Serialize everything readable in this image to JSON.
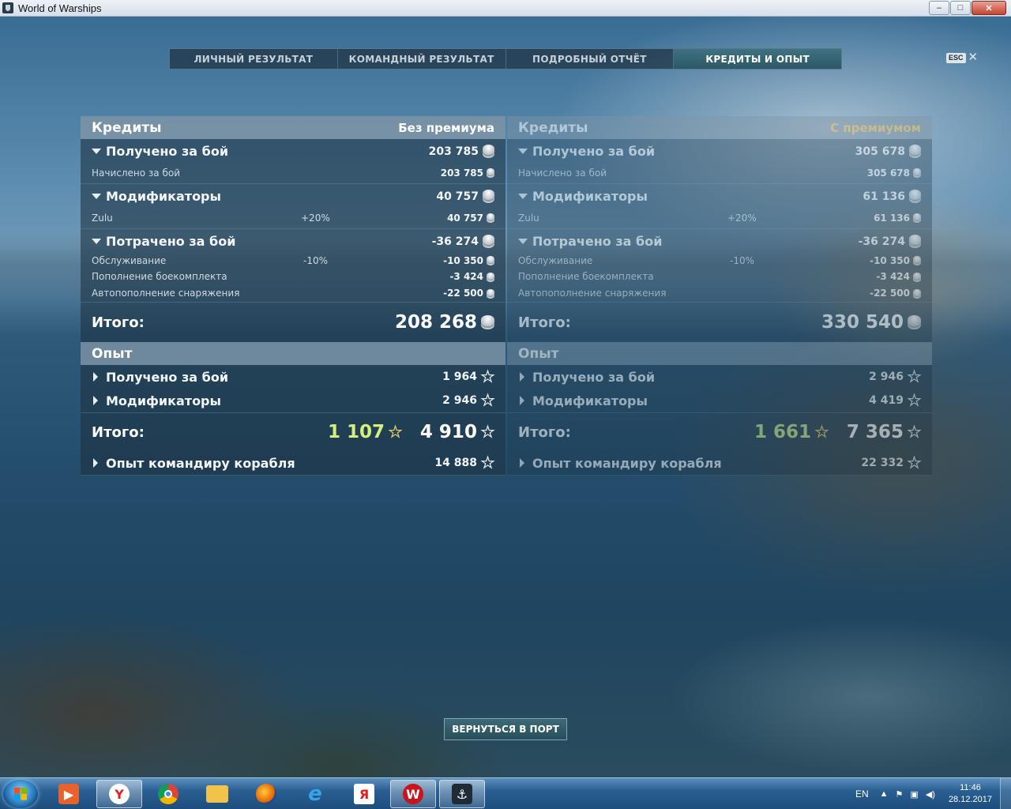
{
  "window": {
    "title": "World of Warships",
    "min": "–",
    "max": "□",
    "close": "✕"
  },
  "tabs": [
    {
      "label": "ЛИЧНЫЙ РЕЗУЛЬТАТ"
    },
    {
      "label": "КОМАНДНЫЙ РЕЗУЛЬТАТ"
    },
    {
      "label": "ПОДРОБНЫЙ ОТЧЁТ"
    },
    {
      "label": "КРЕДИТЫ И ОПЫТ"
    }
  ],
  "active_tab": "КРЕДИТЫ И ОПЫТ",
  "esc": {
    "key": "ESC",
    "close": "✕"
  },
  "left": {
    "credits_title": "Кредиты",
    "column_title": "Без премиума",
    "earned": {
      "label": "Получено за бой",
      "value": "203 785"
    },
    "earned_sub": {
      "label": "Начислено за бой",
      "value": "203 785"
    },
    "modifiers": {
      "label": "Модификаторы",
      "value": "40 757"
    },
    "modifier_zulu": {
      "label": "Zulu",
      "pct": "+20%",
      "value": "40 757"
    },
    "spent": {
      "label": "Потрачено за бой",
      "value": "-36 274"
    },
    "service": {
      "label": "Обслуживание",
      "pct": "-10%",
      "value": "-10 350"
    },
    "ammo": {
      "label": "Пополнение боекомплекта",
      "value": "-3 424"
    },
    "supplies": {
      "label": "Автопополнение снаряжения",
      "value": "-22 500"
    },
    "total": {
      "label": "Итого:",
      "value": "208 268"
    },
    "exp_title": "Опыт",
    "exp_earned": {
      "label": "Получено за бой",
      "value": "1 964"
    },
    "exp_modifiers": {
      "label": "Модификаторы",
      "value": "2 946"
    },
    "exp_total": {
      "label": "Итого:",
      "free": "1 107",
      "value": "4 910"
    },
    "commander": {
      "label": "Опыт командиру корабля",
      "value": "14 888"
    }
  },
  "right": {
    "credits_title": "Кредиты",
    "column_title": "С премиумом",
    "earned": {
      "label": "Получено за бой",
      "value": "305 678"
    },
    "earned_sub": {
      "label": "Начислено за бой",
      "value": "305 678"
    },
    "modifiers": {
      "label": "Модификаторы",
      "value": "61 136"
    },
    "modifier_zulu": {
      "label": "Zulu",
      "pct": "+20%",
      "value": "61 136"
    },
    "spent": {
      "label": "Потрачено за бой",
      "value": "-36 274"
    },
    "service": {
      "label": "Обслуживание",
      "pct": "-10%",
      "value": "-10 350"
    },
    "ammo": {
      "label": "Пополнение боекомплекта",
      "value": "-3 424"
    },
    "supplies": {
      "label": "Автопополнение снаряжения",
      "value": "-22 500"
    },
    "total": {
      "label": "Итого:",
      "value": "330 540"
    },
    "exp_title": "Опыт",
    "exp_earned": {
      "label": "Получено за бой",
      "value": "2 946"
    },
    "exp_modifiers": {
      "label": "Модификаторы",
      "value": "4 419"
    },
    "exp_total": {
      "label": "Итого:",
      "free": "1 661",
      "value": "7 365"
    },
    "commander": {
      "label": "Опыт командиру корабля",
      "value": "22 332"
    }
  },
  "return_button": "ВЕРНУТЬСЯ В ПОРТ",
  "taskbar": {
    "apps": [
      "media-player",
      "yandex-browser",
      "chrome",
      "file-explorer",
      "firefox",
      "internet-explorer",
      "yandex",
      "wargaming-game-center",
      "world-of-warships"
    ],
    "lang": "EN",
    "time": "11:46",
    "date": "28.12.2017"
  },
  "colors": {
    "active_tab": "#3f7282",
    "premium_label": "#f3c35a",
    "free_exp": "#d4f07a"
  }
}
